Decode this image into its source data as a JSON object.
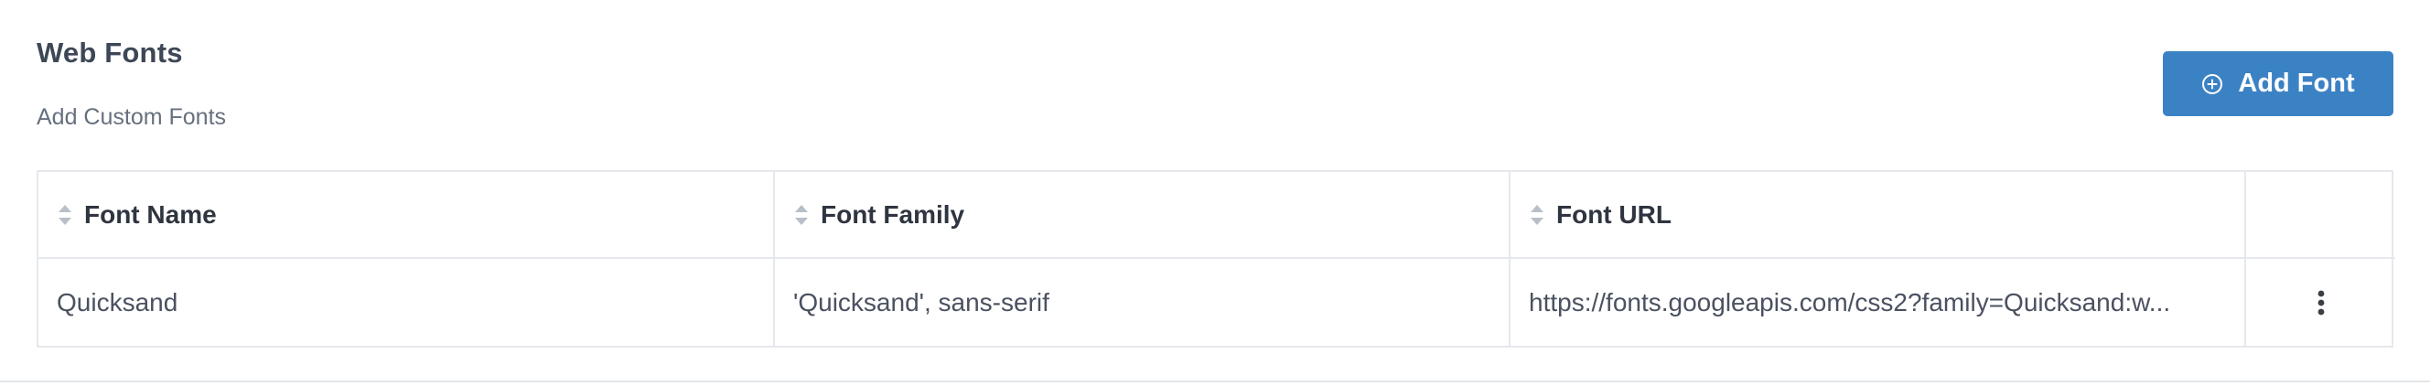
{
  "header": {
    "title": "Web Fonts",
    "subtitle": "Add Custom Fonts",
    "add_button_label": "Add Font",
    "add_button_icon": "plus-circle-icon"
  },
  "table": {
    "columns": [
      {
        "label": "Font Name",
        "sortable": true
      },
      {
        "label": "Font Family",
        "sortable": true
      },
      {
        "label": "Font URL",
        "sortable": true
      },
      {
        "label": "",
        "sortable": false
      }
    ],
    "rows": [
      {
        "name": "Quicksand",
        "family": "'Quicksand', sans-serif",
        "url": "https://fonts.googleapis.com/css2?family=Quicksand:w...",
        "actions_icon": "kebab-menu-icon"
      }
    ]
  },
  "colors": {
    "accent": "#3b82c4",
    "border": "#e5e8ec",
    "title": "#3d4756",
    "subtitle": "#66707e"
  }
}
